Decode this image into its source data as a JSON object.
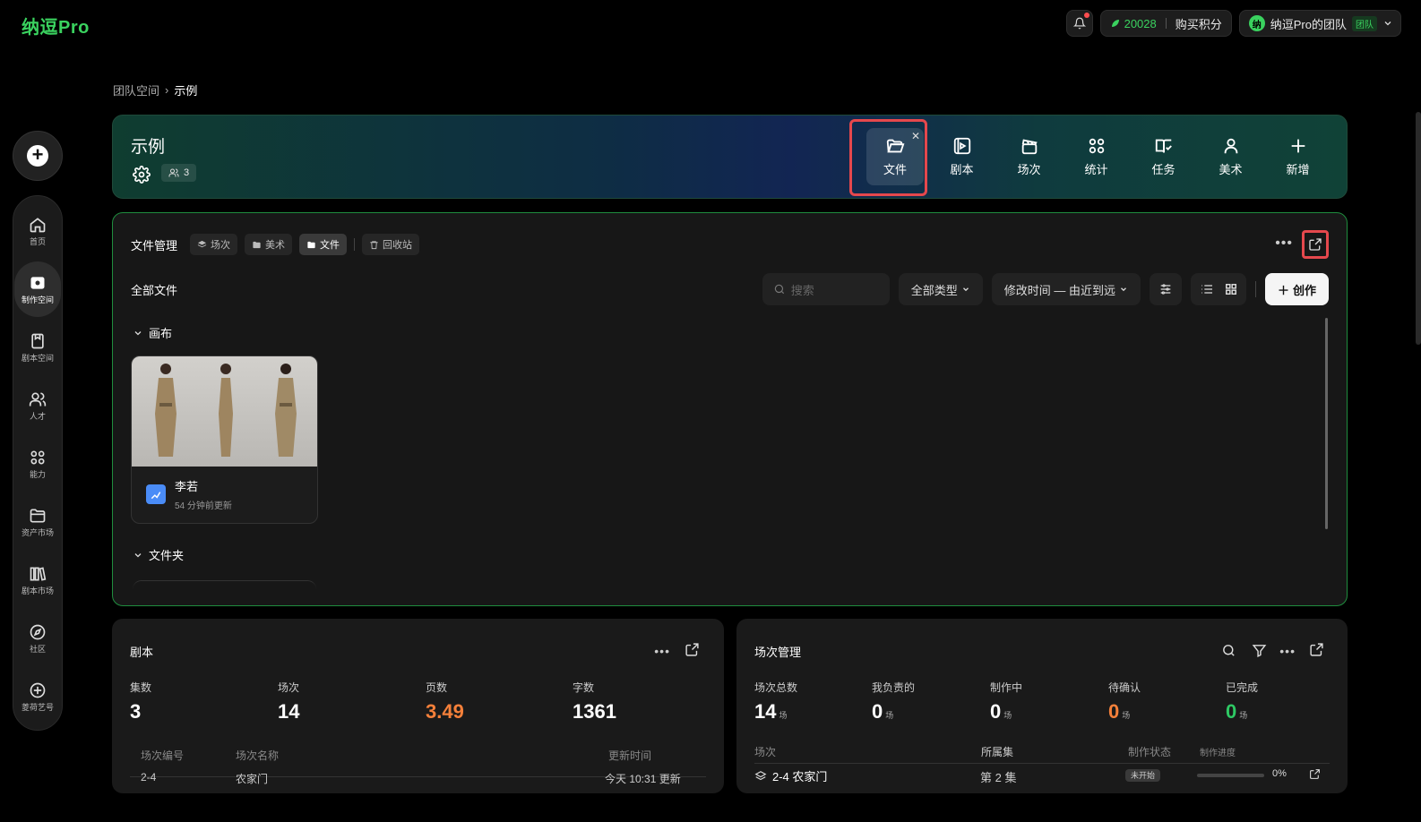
{
  "app": {
    "logo": "纳逗Pro"
  },
  "topbar": {
    "points": "20028",
    "buy_label": "购买积分",
    "team_avatar": "纳",
    "team_name": "纳逗Pro的团队",
    "team_tag": "团队"
  },
  "sidebar": {
    "items": [
      {
        "label": "首页",
        "icon": "home-icon"
      },
      {
        "label": "制作空间",
        "icon": "studio-icon"
      },
      {
        "label": "剧本空间",
        "icon": "script-icon"
      },
      {
        "label": "人才",
        "icon": "people-icon"
      },
      {
        "label": "能力",
        "icon": "apps-icon"
      },
      {
        "label": "资产市场",
        "icon": "folder-icon"
      },
      {
        "label": "剧本市场",
        "icon": "library-icon"
      },
      {
        "label": "社区",
        "icon": "compass-icon"
      },
      {
        "label": "菱荷艺号",
        "icon": "plus-circle-icon"
      }
    ]
  },
  "breadcrumb": {
    "parent": "团队空间",
    "separator": "›",
    "current": "示例"
  },
  "project": {
    "title": "示例",
    "members": "3",
    "tools": [
      {
        "label": "文件",
        "icon": "folder-open-icon"
      },
      {
        "label": "剧本",
        "icon": "video-icon"
      },
      {
        "label": "场次",
        "icon": "clapper-icon"
      },
      {
        "label": "统计",
        "icon": "grid-icon"
      },
      {
        "label": "任务",
        "icon": "book-check-icon"
      },
      {
        "label": "美术",
        "icon": "person-icon"
      },
      {
        "label": "新增",
        "icon": "plus-icon"
      }
    ]
  },
  "files": {
    "title": "文件管理",
    "chips": [
      "场次",
      "美术",
      "文件",
      "回收站"
    ],
    "subtitle": "全部文件",
    "search_placeholder": "搜索",
    "type_filter": "全部类型",
    "sort": "修改时间 — 由近到远",
    "create_label": "创作",
    "group_canvas": "画布",
    "group_folder": "文件夹",
    "card": {
      "name": "李若",
      "time": "54 分钟前更新"
    }
  },
  "script_panel": {
    "title": "剧本",
    "stats": [
      {
        "label": "集数",
        "value": "3"
      },
      {
        "label": "场次",
        "value": "14"
      },
      {
        "label": "页数",
        "value": "3.49"
      },
      {
        "label": "字数",
        "value": "1361"
      }
    ],
    "columns": [
      "场次编号",
      "场次名称",
      "更新时间"
    ],
    "row": {
      "no": "2-4",
      "name": "农家门",
      "time": "今天 10:31 更新"
    }
  },
  "scene_panel": {
    "title": "场次管理",
    "unit": "场",
    "stats": [
      {
        "label": "场次总数",
        "value": "14"
      },
      {
        "label": "我负责的",
        "value": "0"
      },
      {
        "label": "制作中",
        "value": "0"
      },
      {
        "label": "待确认",
        "value": "0"
      },
      {
        "label": "已完成",
        "value": "0"
      }
    ],
    "columns": [
      "场次",
      "所属集",
      "制作状态",
      "制作进度"
    ],
    "row": {
      "scene": "2-4 农家门",
      "episode": "第 2 集",
      "status": "未开始",
      "progress": "0%"
    }
  },
  "colors": {
    "accent": "#3ad25f",
    "highlight": "#e5484d",
    "orange": "#f5803a"
  }
}
